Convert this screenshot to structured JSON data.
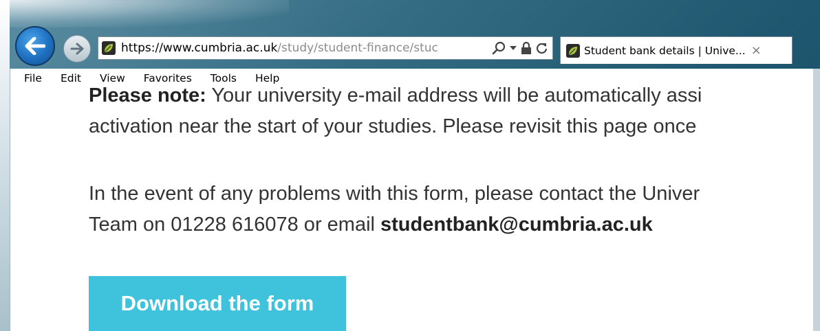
{
  "browser": {
    "address": {
      "url_prefix": "https://www.",
      "url_domain": "cumbria.ac.uk",
      "url_path": "/study/student-finance/stuc"
    },
    "tab": {
      "title": "Student bank details | Unive...",
      "close": "×"
    },
    "menu": [
      "File",
      "Edit",
      "View",
      "Favorites",
      "Tools",
      "Help"
    ]
  },
  "page": {
    "note_line1_bold": "Please note:",
    "note_line1_rest": " Your university e-mail address will be automatically assi",
    "note_line2": "activation near the start of your studies.  Please revisit this page once",
    "contact_line1": "In the event of any problems with this form, please contact the Univer",
    "contact_line2_text": "Team on 01228 616078 or email ",
    "contact_email": "studentbank@cumbria.ac.uk",
    "download_button": "Download the form"
  },
  "colors": {
    "button_bg": "#3fc3dc",
    "chrome_blue": "#1f5770"
  }
}
